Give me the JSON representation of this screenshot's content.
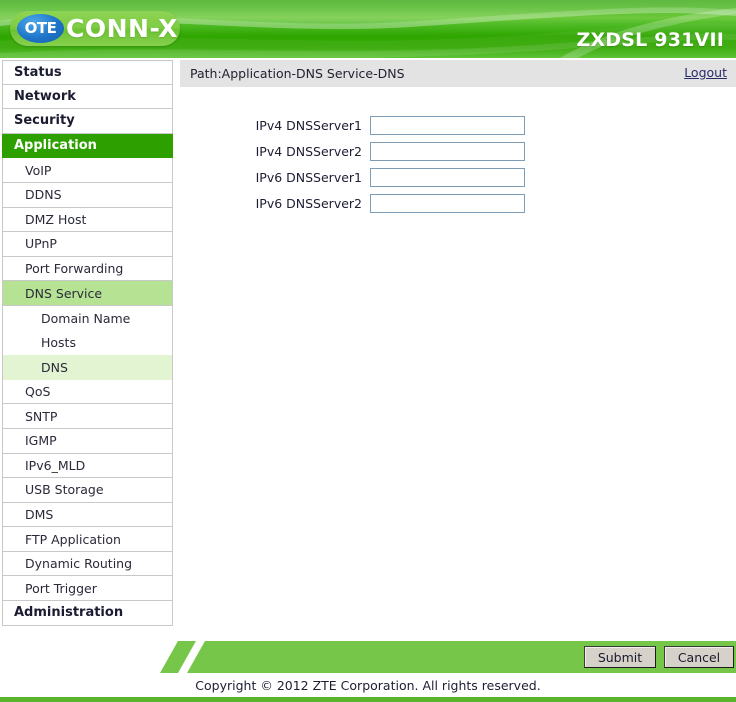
{
  "header": {
    "logo_badge": "OTE",
    "logo_text": "CONN-X",
    "model": "ZXDSL 931VII",
    "brand_green": "#2da000",
    "accent_green": "#76c64a"
  },
  "sidebar": {
    "items": [
      {
        "label": "Status",
        "level": "top",
        "state": "normal"
      },
      {
        "label": "Network",
        "level": "top",
        "state": "normal"
      },
      {
        "label": "Security",
        "level": "top",
        "state": "normal"
      },
      {
        "label": "Application",
        "level": "top",
        "state": "active"
      },
      {
        "label": "VoIP",
        "level": "sub",
        "state": "normal"
      },
      {
        "label": "DDNS",
        "level": "sub",
        "state": "normal"
      },
      {
        "label": "DMZ Host",
        "level": "sub",
        "state": "normal"
      },
      {
        "label": "UPnP",
        "level": "sub",
        "state": "normal"
      },
      {
        "label": "Port Forwarding",
        "level": "sub",
        "state": "normal"
      },
      {
        "label": "DNS Service",
        "level": "sub",
        "state": "active"
      },
      {
        "label": "Domain Name",
        "level": "sub2",
        "state": "normal"
      },
      {
        "label": "Hosts",
        "level": "sub2",
        "state": "normal"
      },
      {
        "label": "DNS",
        "level": "sub2",
        "state": "active"
      },
      {
        "label": "QoS",
        "level": "sub",
        "state": "normal"
      },
      {
        "label": "SNTP",
        "level": "sub",
        "state": "normal"
      },
      {
        "label": "IGMP",
        "level": "sub",
        "state": "normal"
      },
      {
        "label": "IPv6_MLD",
        "level": "sub",
        "state": "normal"
      },
      {
        "label": "USB Storage",
        "level": "sub",
        "state": "normal"
      },
      {
        "label": "DMS",
        "level": "sub",
        "state": "normal"
      },
      {
        "label": "FTP Application",
        "level": "sub",
        "state": "normal"
      },
      {
        "label": "Dynamic Routing",
        "level": "sub",
        "state": "normal"
      },
      {
        "label": "Port Trigger",
        "level": "sub",
        "state": "normal"
      },
      {
        "label": "Administration",
        "level": "top",
        "state": "normal"
      }
    ]
  },
  "content": {
    "path": "Path:Application-DNS Service-DNS",
    "logout_label": "Logout",
    "fields": [
      {
        "label": "IPv4 DNSServer1",
        "value": "",
        "placeholder": ""
      },
      {
        "label": "IPv4 DNSServer2",
        "value": "",
        "placeholder": ""
      },
      {
        "label": "IPv6 DNSServer1",
        "value": "",
        "placeholder": ""
      },
      {
        "label": "IPv6 DNSServer2",
        "value": "",
        "placeholder": ""
      }
    ]
  },
  "actions": {
    "submit_label": "Submit",
    "cancel_label": "Cancel"
  },
  "footer": {
    "copyright": "Copyright © 2012 ZTE Corporation. All rights reserved."
  }
}
